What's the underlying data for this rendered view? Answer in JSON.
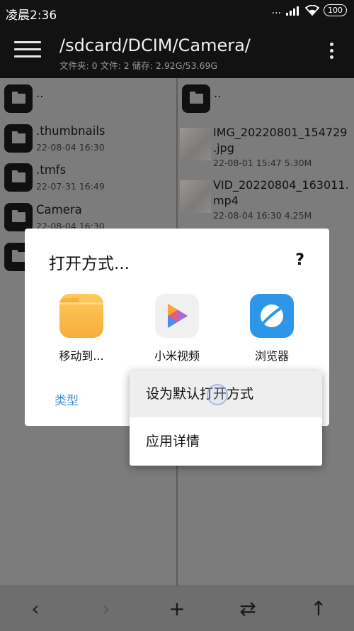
{
  "status": {
    "time": "凌晨2:36",
    "battery": "100",
    "dots": "...",
    "signal": "..ıl"
  },
  "header": {
    "path": "/sdcard/DCIM/Camera/",
    "info": "文件夹: 0  文件: 2  储存: 2.92G/53.69G"
  },
  "left_pane": {
    "items": [
      {
        "name": "..",
        "meta": ""
      },
      {
        "name": ".thumbnails",
        "meta": "22-08-04 16:30"
      },
      {
        "name": ".tmfs",
        "meta": "22-07-31 16:49"
      },
      {
        "name": "Camera",
        "meta": "22-08-04 16:30"
      }
    ]
  },
  "right_pane": {
    "parent": "..",
    "files": [
      {
        "name_line1": "IMG_20220801_154729",
        "name_line2": ".jpg",
        "meta": "22-08-01 15:47  5.30M"
      },
      {
        "name_line1": "VID_20220804_163011.",
        "name_line2": "mp4",
        "meta": "22-08-04 16:30  4.25M"
      }
    ]
  },
  "dialog": {
    "title": "打开方式...",
    "help": "?",
    "apps": [
      {
        "label": "移动到...",
        "icon": "folder-icon"
      },
      {
        "label": "小米视频",
        "icon": "video-play-icon"
      },
      {
        "label": "浏览器",
        "icon": "browser-icon"
      }
    ],
    "type_link": "类型"
  },
  "popup": {
    "items": [
      "设为默认打开方式",
      "应用详情"
    ]
  },
  "bottom_nav": {
    "back": "‹",
    "forward": "›",
    "add": "+",
    "swap": "⇄",
    "up": "↑"
  },
  "colors": {
    "accent": "#3a8ed6",
    "browser": "#2d96e8",
    "folder": "#f6ad3b"
  }
}
